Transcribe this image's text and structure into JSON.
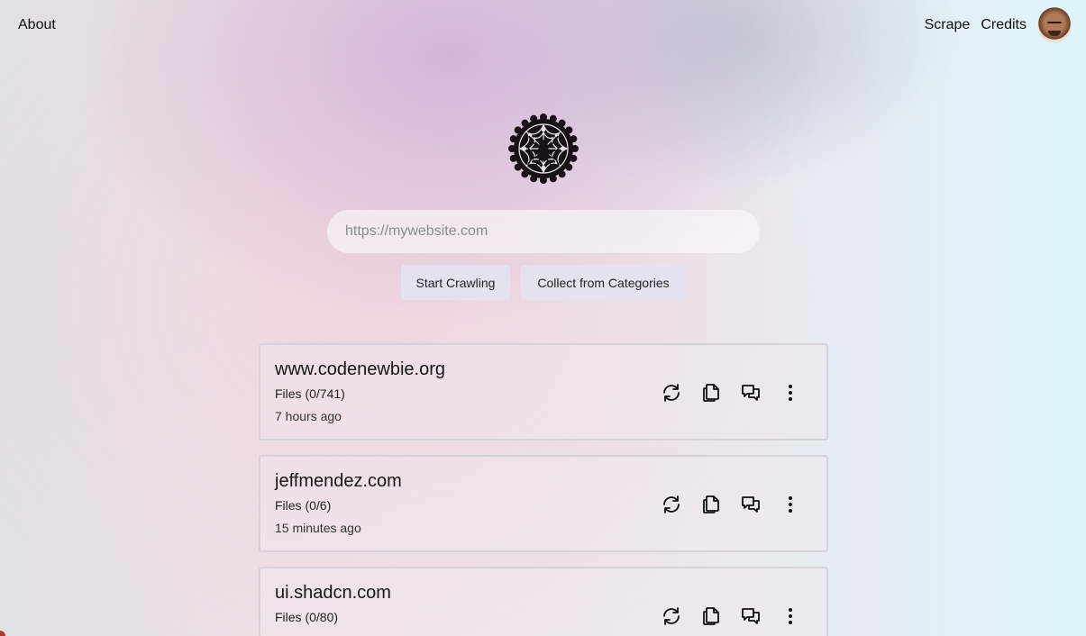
{
  "header": {
    "about_label": "About",
    "scrape_label": "Scrape",
    "credits_label": "Credits"
  },
  "search": {
    "placeholder": "https://mywebsite.com"
  },
  "actions": {
    "start_label": "Start Crawling",
    "collect_label": "Collect from Categories"
  },
  "sites": [
    {
      "domain": "www.codenewbie.org",
      "files": "Files (0/741)",
      "time": "7 hours ago"
    },
    {
      "domain": "jeffmendez.com",
      "files": "Files (0/6)",
      "time": "15 minutes ago"
    },
    {
      "domain": "ui.shadcn.com",
      "files": "Files (0/80)",
      "time": ""
    }
  ],
  "icons": {
    "logo": "spider-web-logo",
    "refresh": "refresh-icon",
    "copy": "copy-icon",
    "chat": "chat-icon",
    "more": "more-vertical-icon"
  }
}
